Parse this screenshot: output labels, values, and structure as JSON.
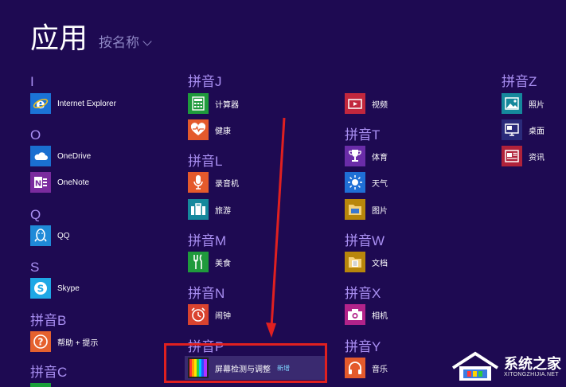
{
  "header": {
    "title": "应用",
    "sort_label": "按名称"
  },
  "groups": {
    "I": {
      "letter": "I",
      "apps": [
        {
          "label": "Internet Explorer"
        }
      ]
    },
    "O": {
      "letter": "O",
      "apps": [
        {
          "label": "OneDrive"
        },
        {
          "label": "OneNote"
        }
      ]
    },
    "Q": {
      "letter": "Q",
      "apps": [
        {
          "label": "QQ"
        }
      ]
    },
    "S": {
      "letter": "S",
      "apps": [
        {
          "label": "Skype"
        }
      ]
    },
    "B": {
      "letter": "拼音B",
      "apps": [
        {
          "label": "帮助 + 提示"
        }
      ]
    },
    "C": {
      "letter": "拼音C"
    },
    "J": {
      "letter": "拼音J",
      "apps": [
        {
          "label": "计算器"
        },
        {
          "label": "健康"
        }
      ]
    },
    "L": {
      "letter": "拼音L",
      "apps": [
        {
          "label": "录音机"
        },
        {
          "label": "旅游"
        }
      ]
    },
    "M": {
      "letter": "拼音M",
      "apps": [
        {
          "label": "美食"
        }
      ]
    },
    "N": {
      "letter": "拼音N",
      "apps": [
        {
          "label": "闹钟"
        }
      ]
    },
    "P": {
      "letter": "拼音P",
      "apps": [
        {
          "label": "屏幕检测与调整",
          "badge": "新增"
        }
      ]
    },
    "S2": {
      "apps": [
        {
          "label": "视频"
        }
      ]
    },
    "T": {
      "letter": "拼音T",
      "apps": [
        {
          "label": "体育"
        },
        {
          "label": "天气"
        },
        {
          "label": "图片"
        }
      ]
    },
    "W": {
      "letter": "拼音W",
      "apps": [
        {
          "label": "文档"
        }
      ]
    },
    "X": {
      "letter": "拼音X",
      "apps": [
        {
          "label": "相机"
        }
      ]
    },
    "Y": {
      "letter": "拼音Y",
      "apps": [
        {
          "label": "音乐"
        }
      ]
    },
    "Z": {
      "letter": "拼音Z",
      "apps": [
        {
          "label": "照片"
        },
        {
          "label": "桌面"
        },
        {
          "label": "资讯"
        }
      ]
    }
  },
  "watermark": {
    "brand": "系统之家",
    "url": "XITONGZHIJIA.NET"
  },
  "colors": {
    "background": "#1e0a52",
    "header_accent": "#a98ff2",
    "highlight_box": "#e02020",
    "annotation_arrow": "#e02020"
  }
}
